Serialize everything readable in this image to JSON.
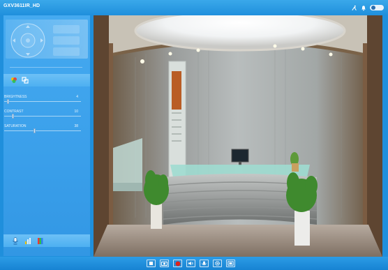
{
  "window": {
    "title": "GXV3611IR_HD"
  },
  "header_icons": [
    "runner-icon",
    "bell-icon",
    "power-toggle-icon"
  ],
  "image_adjust": {
    "tool_icons": [
      "color-palette-icon",
      "copy-settings-icon"
    ],
    "sliders": [
      {
        "label": "BRIGHTNESS",
        "value": "4",
        "level": 0.04
      },
      {
        "label": "CONTRAST",
        "value": "10",
        "level": 0.1
      },
      {
        "label": "SATURATION",
        "value": "38",
        "level": 0.38
      }
    ]
  },
  "bottom_left_icons": [
    "microphone-icon",
    "audio-level-icon",
    "color-bars-icon"
  ],
  "playback_controls": [
    "stop-icon",
    "snapshot-icon",
    "record-icon",
    "volume-icon",
    "talk-icon",
    "settings-icon",
    "fullscreen-icon"
  ],
  "colors": {
    "accent": "#1f8fdc",
    "panel": "#3a9fea",
    "record": "#e0221b"
  }
}
